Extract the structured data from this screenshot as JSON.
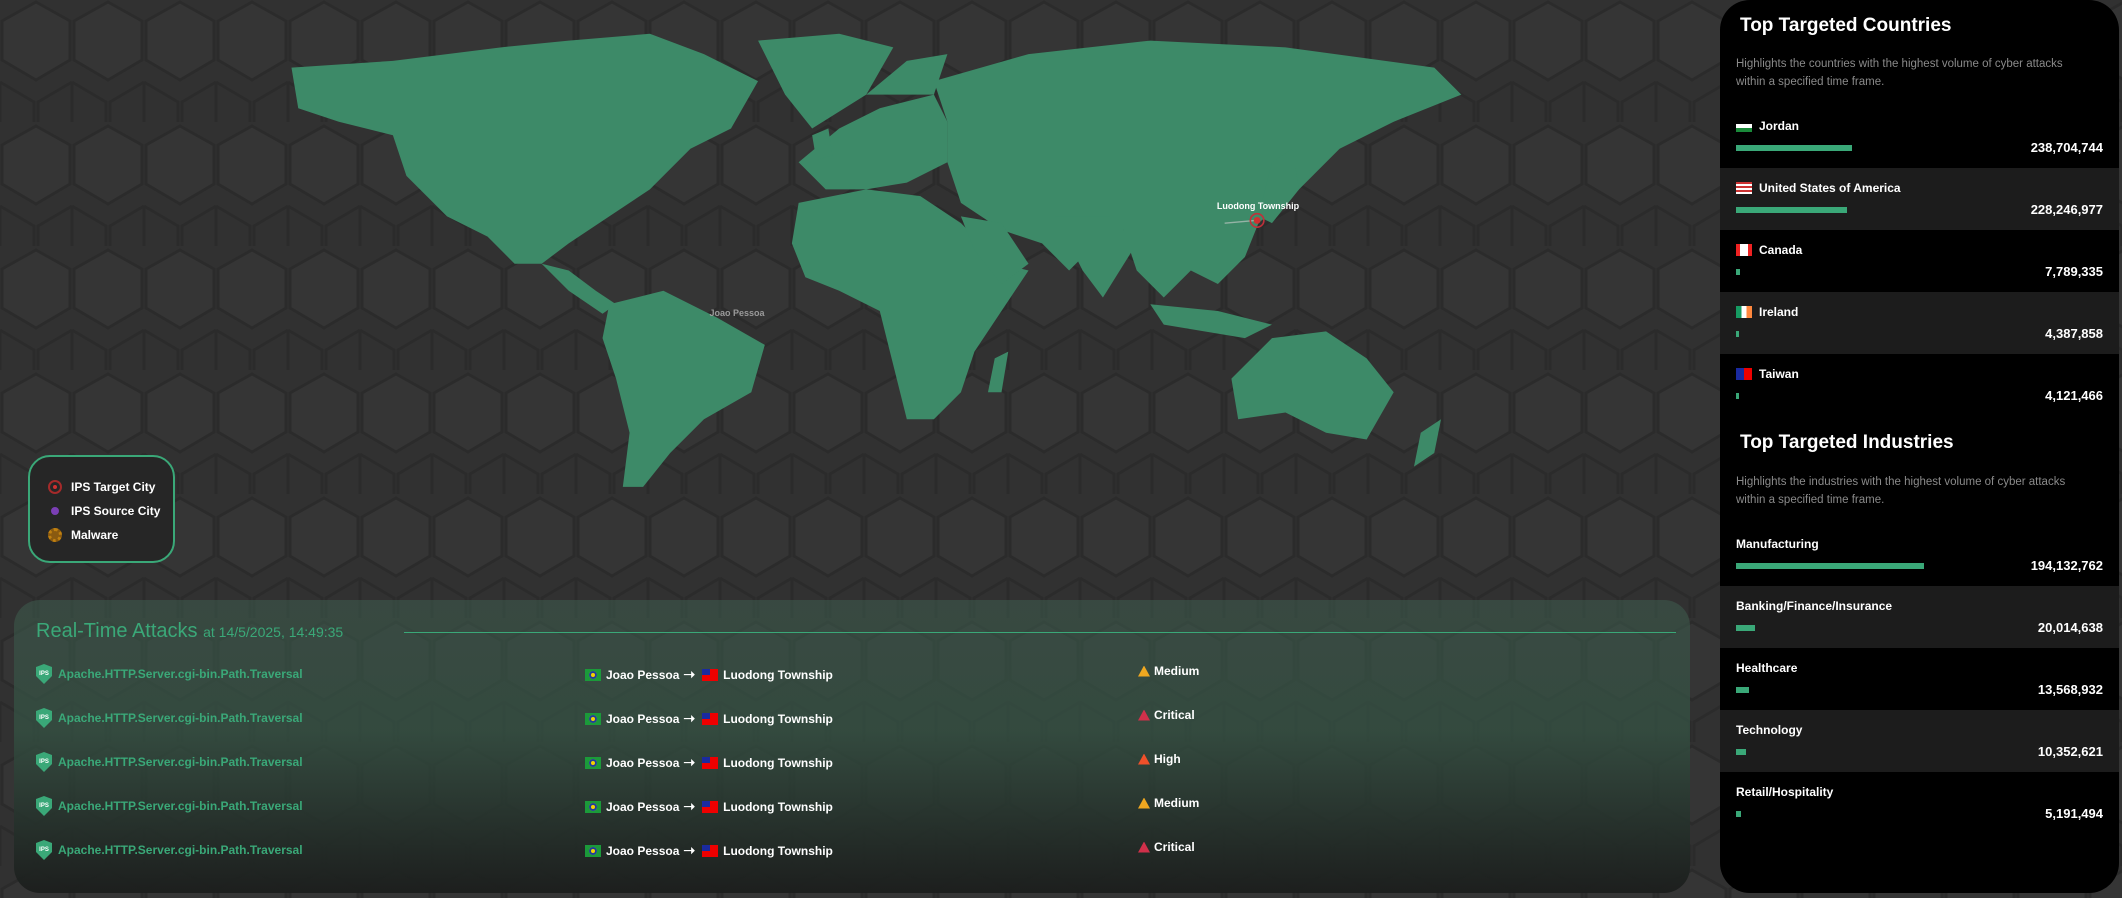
{
  "map": {
    "land_color": "#3d8a68",
    "target_label": "Luodong Township",
    "source_label": "Joao Pessoa"
  },
  "legend": {
    "items": [
      {
        "label": "IPS Target City",
        "icon": "target-circle-icon",
        "color": "#d03030"
      },
      {
        "label": "IPS Source City",
        "icon": "dot-icon",
        "color": "#7b3fb5"
      },
      {
        "label": "Malware",
        "icon": "malware-icon",
        "color": "#c08010"
      }
    ]
  },
  "attacks": {
    "title": "Real-Time Attacks",
    "timestamp": "at 14/5/2025, 14:49:35",
    "ips_badge": "IPS",
    "rows": [
      {
        "name": "Apache.HTTP.Server.cgi-bin.Path.Traversal",
        "source": "Joao Pessoa",
        "target": "Luodong Township",
        "severity": "Medium",
        "severity_color": "#f0a820"
      },
      {
        "name": "Apache.HTTP.Server.cgi-bin.Path.Traversal",
        "source": "Joao Pessoa",
        "target": "Luodong Township",
        "severity": "Critical",
        "severity_color": "#d0304a"
      },
      {
        "name": "Apache.HTTP.Server.cgi-bin.Path.Traversal",
        "source": "Joao Pessoa",
        "target": "Luodong Township",
        "severity": "High",
        "severity_color": "#f0502a"
      },
      {
        "name": "Apache.HTTP.Server.cgi-bin.Path.Traversal",
        "source": "Joao Pessoa",
        "target": "Luodong Township",
        "severity": "Medium",
        "severity_color": "#f0a820"
      },
      {
        "name": "Apache.HTTP.Server.cgi-bin.Path.Traversal",
        "source": "Joao Pessoa",
        "target": "Luodong Township",
        "severity": "Critical",
        "severity_color": "#d0304a"
      }
    ]
  },
  "countries": {
    "title": "Top Targeted Countries",
    "description": "Highlights the countries with the highest volume of cyber attacks within a specified time frame.",
    "items": [
      {
        "name": "Jordan",
        "value": "238,704,744",
        "amount": 238704744,
        "flag": "linear-gradient(#000 33%,#fff 33% 66%,#1a8a3a 66%)"
      },
      {
        "name": "United States of America",
        "value": "228,246,977",
        "amount": 228246977,
        "flag": "repeating-linear-gradient(#c33 0 2px,#fff 2px 4px)"
      },
      {
        "name": "Canada",
        "value": "7,789,335",
        "amount": 7789335,
        "flag": "linear-gradient(90deg,#e22 25%,#fff 25% 75%,#e22 75%)"
      },
      {
        "name": "Ireland",
        "value": "4,387,858",
        "amount": 4387858,
        "flag": "linear-gradient(90deg,#169b62 33%,#fff 33% 66%,#ff883e 66%)"
      },
      {
        "name": "Taiwan",
        "value": "4,121,466",
        "amount": 4121466,
        "flag": "linear-gradient(90deg,#1a2aa0 50%,#e00 50%)"
      }
    ]
  },
  "industries": {
    "title": "Top Targeted Industries",
    "description": "Highlights the industries with the highest volume of cyber attacks within a specified time frame.",
    "items": [
      {
        "name": "Manufacturing",
        "value": "194,132,762",
        "amount": 194132762
      },
      {
        "name": "Banking/Finance/Insurance",
        "value": "20,014,638",
        "amount": 20014638
      },
      {
        "name": "Healthcare",
        "value": "13,568,932",
        "amount": 13568932
      },
      {
        "name": "Technology",
        "value": "10,352,621",
        "amount": 10352621
      },
      {
        "name": "Retail/Hospitality",
        "value": "5,191,494",
        "amount": 5191494
      }
    ]
  },
  "accent_color": "#3aa878"
}
